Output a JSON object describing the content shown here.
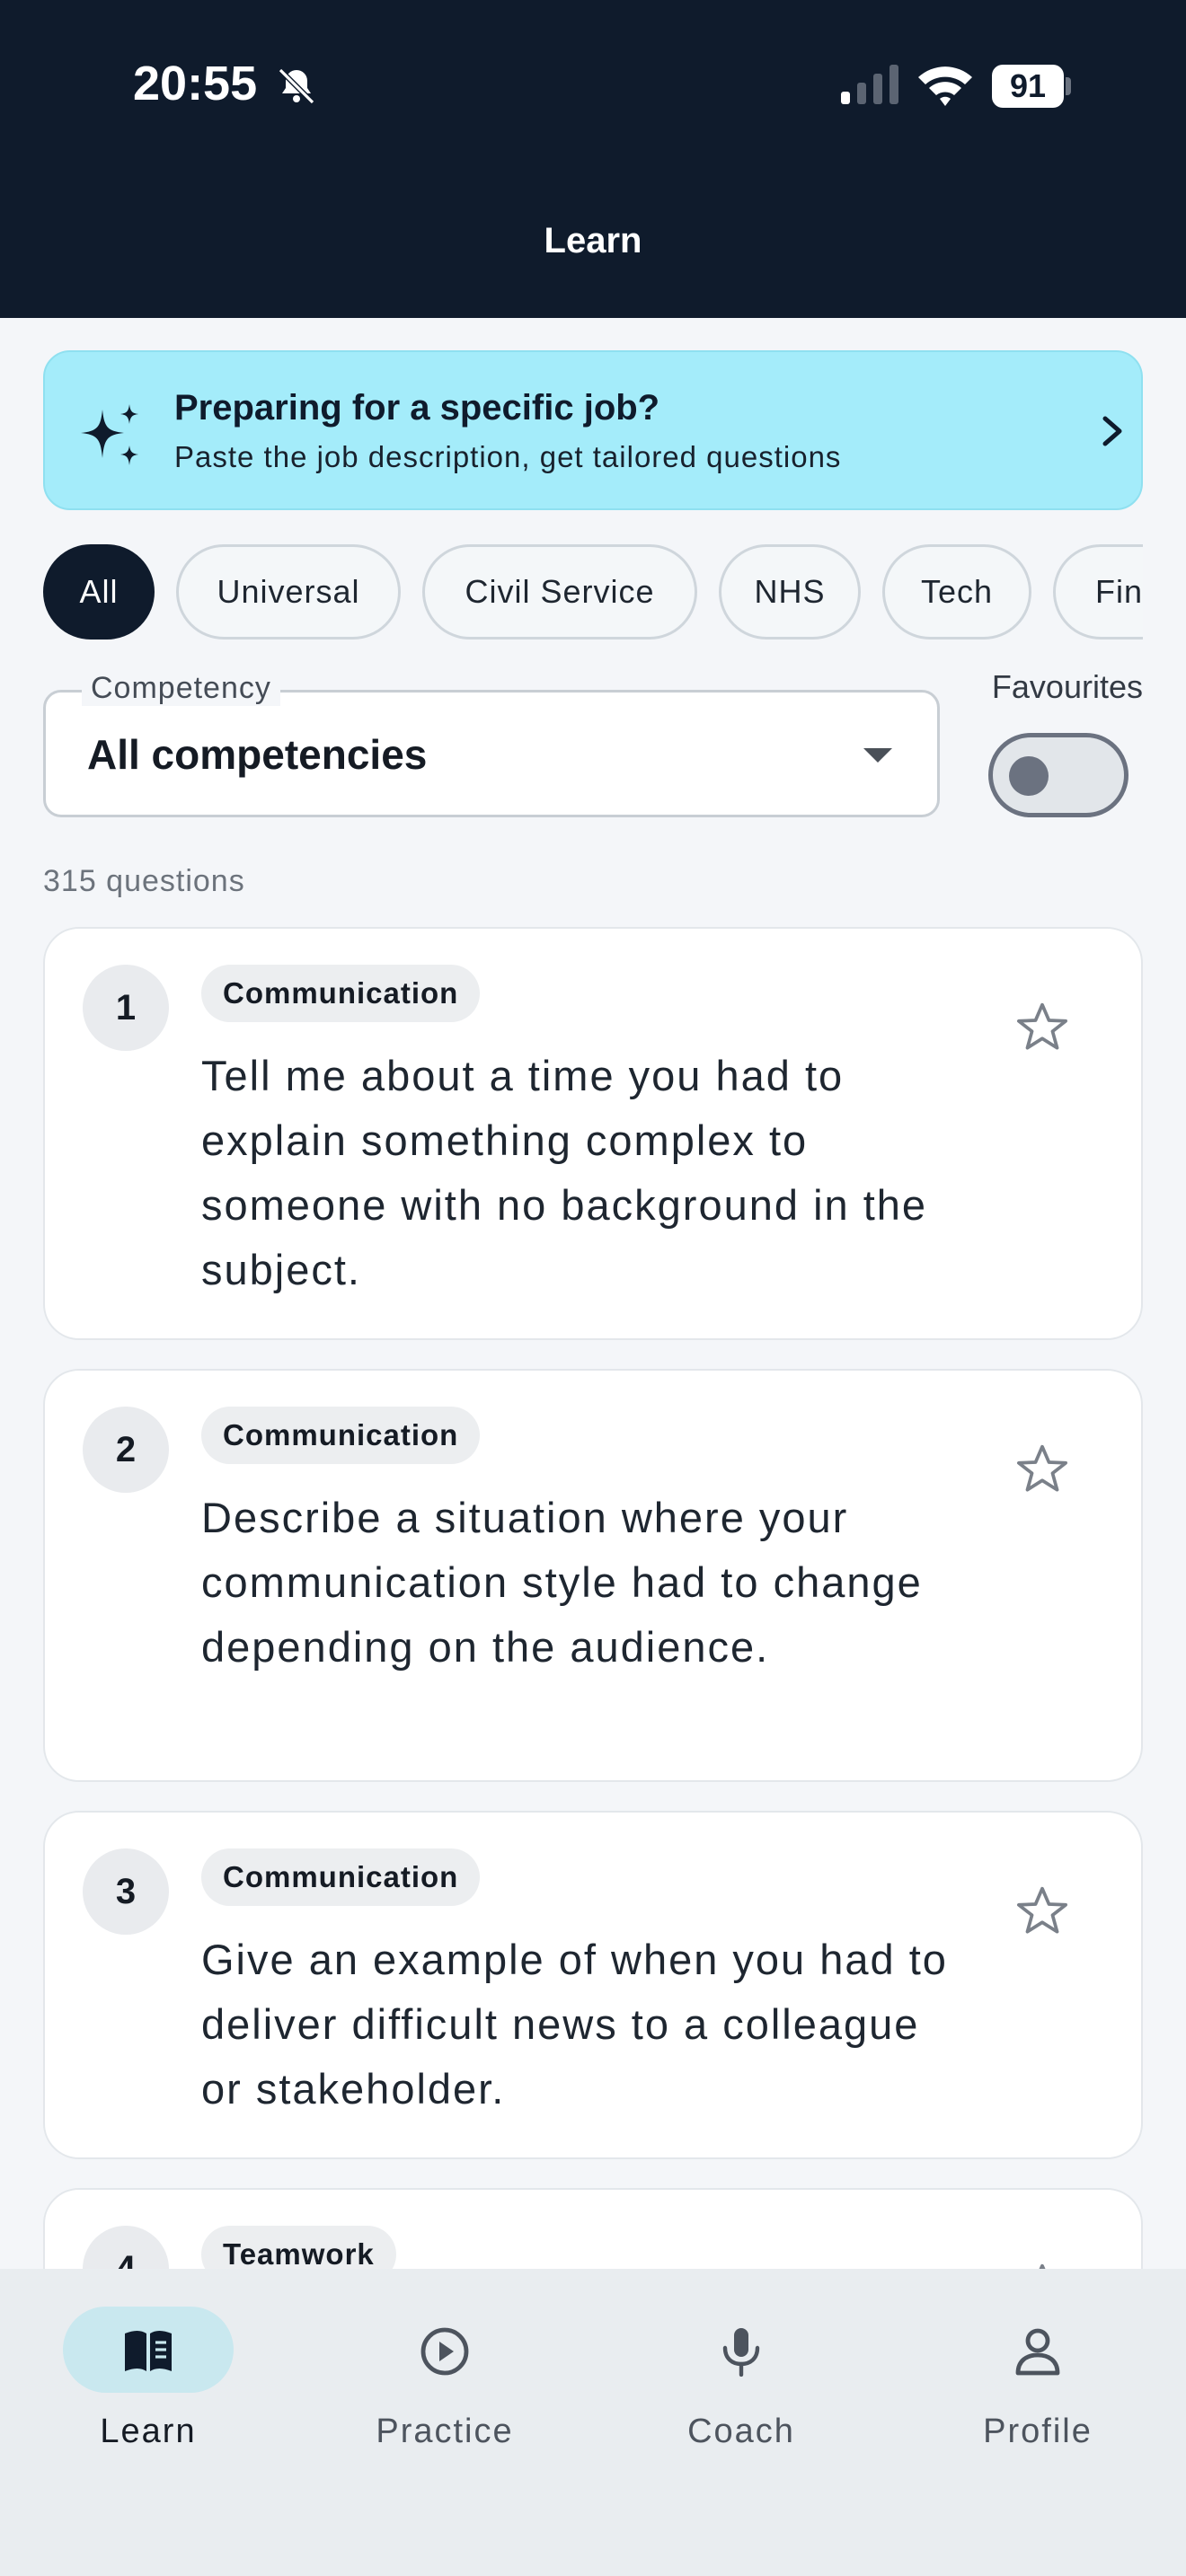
{
  "status_bar": {
    "time": "20:55",
    "battery": "91"
  },
  "header": {
    "title": "Learn"
  },
  "banner": {
    "title": "Preparing for a specific job?",
    "subtitle": "Paste the job description, get tailored questions"
  },
  "filters": {
    "chips": [
      "All",
      "Universal",
      "Civil Service",
      "NHS",
      "Tech",
      "Fina"
    ],
    "active": "All"
  },
  "competency": {
    "label": "Competency",
    "value": "All competencies"
  },
  "favourites": {
    "label": "Favourites",
    "enabled": false
  },
  "question_count": "315 questions",
  "questions": [
    {
      "number": "1",
      "tag": "Communication",
      "text": "Tell me about a time you had to explain something complex to someone with no background in the subject."
    },
    {
      "number": "2",
      "tag": "Communication",
      "text": "Describe a situation where your communication style had to change depending on the audience."
    },
    {
      "number": "3",
      "tag": "Communication",
      "text": "Give an example of when you had to deliver difficult news to a colleague or stakeholder."
    },
    {
      "number": "4",
      "tag": "Teamwork",
      "text": ""
    }
  ],
  "tabbar": {
    "items": [
      {
        "label": "Learn",
        "icon": "book-icon"
      },
      {
        "label": "Practice",
        "icon": "play-circle-icon"
      },
      {
        "label": "Coach",
        "icon": "microphone-icon"
      },
      {
        "label": "Profile",
        "icon": "person-icon"
      }
    ],
    "active": "Learn"
  },
  "colors": {
    "header_bg": "#0f1b2c",
    "banner_bg": "#a4ecfa",
    "active_chip": "#0f1b2c",
    "tab_active_pill": "#c9e8ef"
  }
}
